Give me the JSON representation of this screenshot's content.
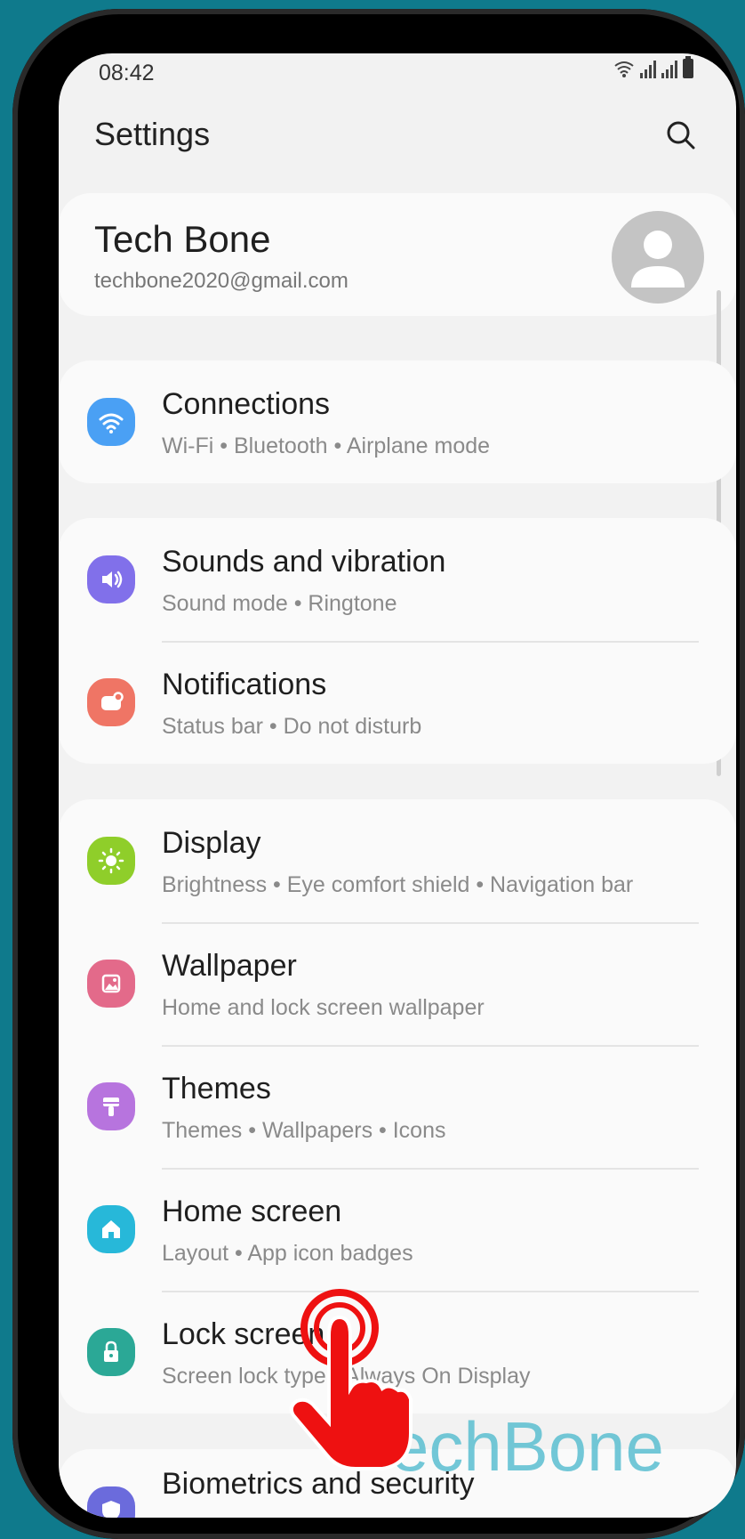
{
  "status": {
    "time": "08:42"
  },
  "header": {
    "title": "Settings"
  },
  "profile": {
    "name": "Tech Bone",
    "email": "techbone2020@gmail.com"
  },
  "items": [
    {
      "label": "Connections",
      "sub": "Wi-Fi  •  Bluetooth  •  Airplane mode",
      "icon": "wifi-icon",
      "color": "#4aa0f4"
    },
    {
      "label": "Sounds and vibration",
      "sub": "Sound mode  •  Ringtone",
      "icon": "volume-icon",
      "color": "#8170ea"
    },
    {
      "label": "Notifications",
      "sub": "Status bar  •  Do not disturb",
      "icon": "notification-icon",
      "color": "#ef7565"
    },
    {
      "label": "Display",
      "sub": "Brightness  •  Eye comfort shield  •  Navigation bar",
      "icon": "brightness-icon",
      "color": "#8fce2a"
    },
    {
      "label": "Wallpaper",
      "sub": "Home and lock screen wallpaper",
      "icon": "wallpaper-icon",
      "color": "#e36a8a"
    },
    {
      "label": "Themes",
      "sub": "Themes  •  Wallpapers  •  Icons",
      "icon": "themes-brush-icon",
      "color": "#b774de"
    },
    {
      "label": "Home screen",
      "sub": "Layout  •  App icon badges",
      "icon": "home-icon",
      "color": "#27b8d9"
    },
    {
      "label": "Lock screen",
      "sub": "Screen lock type  •  Always On Display",
      "icon": "lock-icon",
      "color": "#2ba896"
    },
    {
      "label": "Biometrics and security",
      "icon": "shield-icon",
      "color": "#6b6bdc"
    }
  ],
  "watermark": "TechBone"
}
